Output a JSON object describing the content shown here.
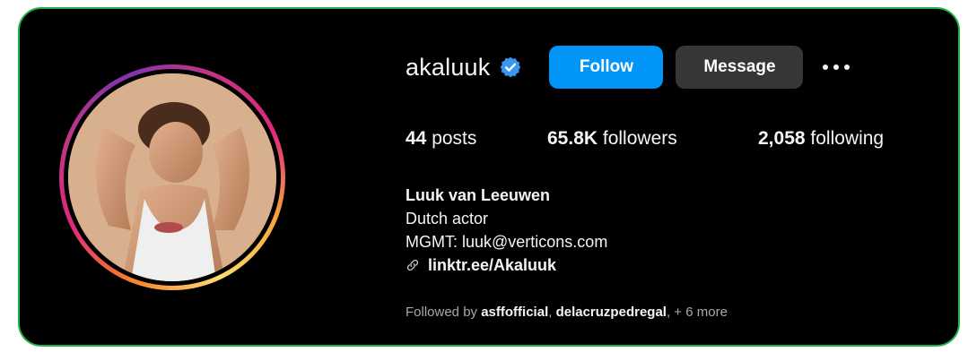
{
  "profile": {
    "username": "akaluuk",
    "verified_icon": "verified-badge-icon",
    "follow_label": "Follow",
    "message_label": "Message",
    "more_icon": "more-options-icon"
  },
  "stats": {
    "posts_count": "44",
    "posts_label": " posts",
    "followers_count": "65.8K",
    "followers_label": " followers",
    "following_count": "2,058",
    "following_label": " following"
  },
  "bio": {
    "full_name": "Luuk van Leeuwen",
    "line1": "Dutch actor",
    "line2": "MGMT: luuk@verticons.com",
    "link_icon": "link-icon",
    "link_text": "linktr.ee/Akaluuk"
  },
  "followed_by": {
    "prefix": "Followed by ",
    "user1": "asffofficial",
    "separator": ", ",
    "user2": "delacruzpedregal",
    "suffix": ", + 6 more"
  },
  "colors": {
    "frame_border": "#22b24c",
    "background": "#000000",
    "follow_button": "#0095f6",
    "message_button": "#363636",
    "verified_badge": "#3897f0"
  }
}
